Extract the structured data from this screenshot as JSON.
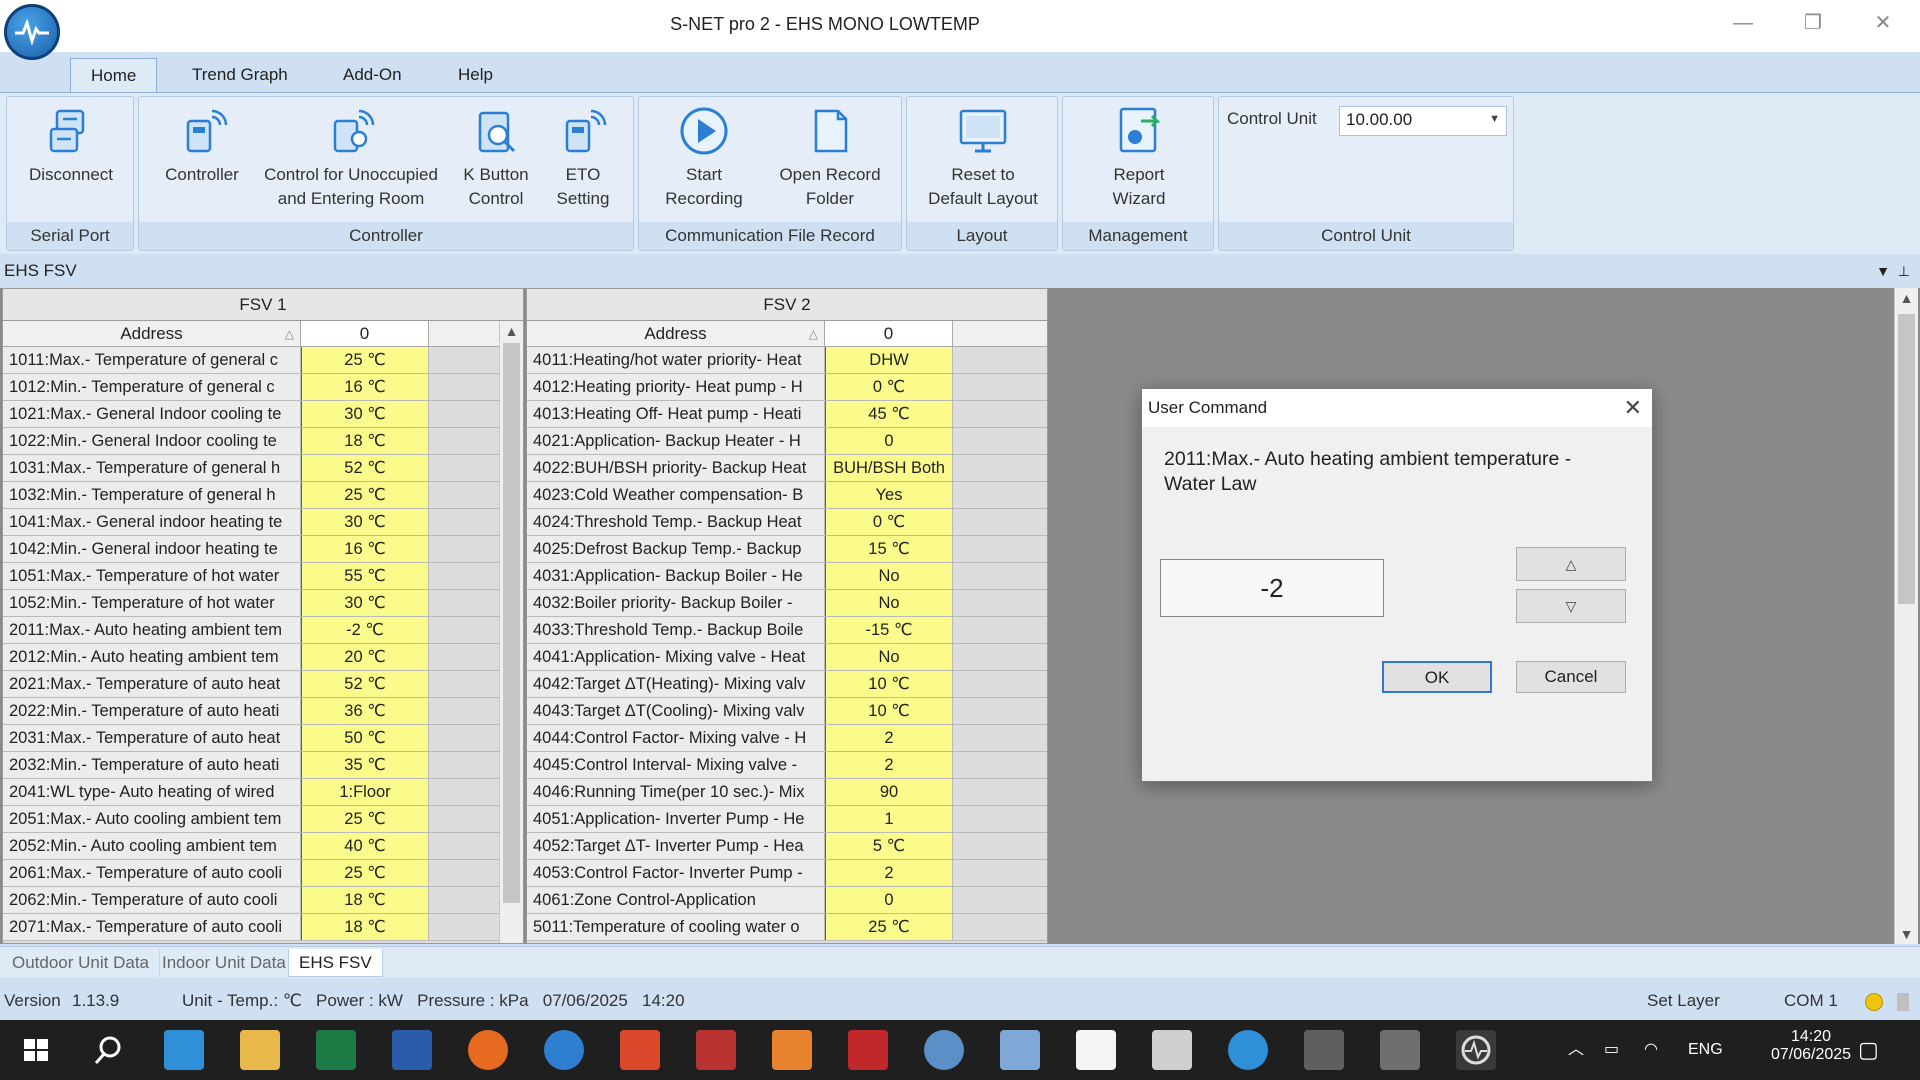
{
  "window": {
    "title": "S-NET pro 2 - EHS MONO LOWTEMP",
    "minimize": "—",
    "restore": "❐",
    "close": "✕"
  },
  "menu": {
    "tabs": [
      "Home",
      "Trend Graph",
      "Add-On",
      "Help"
    ]
  },
  "ribbon": {
    "serial_port": {
      "label": "Serial Port",
      "disconnect": "Disconnect"
    },
    "controller": {
      "label": "Controller",
      "controller": "Controller",
      "control_unoccupied_1": "Control for Unoccupied",
      "control_unoccupied_2": "and Entering Room",
      "k_button_1": "K Button",
      "k_button_2": "Control",
      "eto_1": "ETO",
      "eto_2": "Setting"
    },
    "file_record": {
      "label": "Communication File Record",
      "start_1": "Start",
      "start_2": "Recording",
      "open_1": "Open Record",
      "open_2": "Folder"
    },
    "layout": {
      "label": "Layout",
      "reset_1": "Reset to",
      "reset_2": "Default Layout"
    },
    "management": {
      "label": "Management",
      "report_1": "Report",
      "report_2": "Wizard"
    },
    "control_unit": {
      "label": "Control Unit",
      "field_label": "Control Unit",
      "value": "10.00.00"
    }
  },
  "panel": {
    "title": "EHS FSV"
  },
  "fsv1": {
    "title": "FSV 1",
    "col_address": "Address",
    "col_value": "0",
    "rows": [
      {
        "address": "1011:Max.- Temperature of general c",
        "value": "25 ℃"
      },
      {
        "address": "1012:Min.- Temperature of general c",
        "value": "16 ℃"
      },
      {
        "address": "1021:Max.- General Indoor cooling te",
        "value": "30 ℃"
      },
      {
        "address": "1022:Min.- General Indoor cooling te",
        "value": "18 ℃"
      },
      {
        "address": "1031:Max.- Temperature of general h",
        "value": "52 ℃"
      },
      {
        "address": "1032:Min.- Temperature of general h",
        "value": "25 ℃"
      },
      {
        "address": "1041:Max.- General indoor heating te",
        "value": "30 ℃"
      },
      {
        "address": "1042:Min.- General indoor heating te",
        "value": "16 ℃"
      },
      {
        "address": "1051:Max.- Temperature of hot water",
        "value": "55 ℃"
      },
      {
        "address": "1052:Min.- Temperature of hot water",
        "value": "30 ℃"
      },
      {
        "address": "2011:Max.- Auto heating ambient tem",
        "value": "-2 ℃"
      },
      {
        "address": "2012:Min.- Auto heating ambient tem",
        "value": "20 ℃"
      },
      {
        "address": "2021:Max.- Temperature of auto heat",
        "value": "52 ℃"
      },
      {
        "address": "2022:Min.- Temperature of auto heati",
        "value": "36 ℃"
      },
      {
        "address": "2031:Max.- Temperature of auto heat",
        "value": "50 ℃"
      },
      {
        "address": "2032:Min.- Temperature of auto heati",
        "value": "35 ℃"
      },
      {
        "address": "2041:WL type- Auto heating of wired",
        "value": "1:Floor"
      },
      {
        "address": "2051:Max.- Auto cooling ambient tem",
        "value": "25 ℃"
      },
      {
        "address": "2052:Min.- Auto cooling ambient tem",
        "value": "40 ℃"
      },
      {
        "address": "2061:Max.- Temperature of auto cooli",
        "value": "25 ℃"
      },
      {
        "address": "2062:Min.- Temperature of auto cooli",
        "value": "18 ℃"
      },
      {
        "address": "2071:Max.- Temperature of auto cooli",
        "value": "18 ℃"
      }
    ]
  },
  "fsv2": {
    "title": "FSV 2",
    "col_address": "Address",
    "col_value": "0",
    "rows": [
      {
        "address": "4011:Heating/hot water priority- Heat",
        "value": "DHW"
      },
      {
        "address": "4012:Heating priority- Heat pump - H",
        "value": "0 ℃"
      },
      {
        "address": "4013:Heating Off- Heat pump - Heati",
        "value": "45 ℃"
      },
      {
        "address": "4021:Application- Backup Heater - H",
        "value": "0"
      },
      {
        "address": "4022:BUH/BSH priority- Backup Heat",
        "value": "BUH/BSH Both"
      },
      {
        "address": "4023:Cold Weather compensation- B",
        "value": "Yes"
      },
      {
        "address": "4024:Threshold Temp.- Backup Heat",
        "value": "0 ℃"
      },
      {
        "address": "4025:Defrost Backup Temp.- Backup",
        "value": "15 ℃"
      },
      {
        "address": "4031:Application- Backup Boiler - He",
        "value": "No"
      },
      {
        "address": "4032:Boiler priority- Backup Boiler -",
        "value": "No"
      },
      {
        "address": "4033:Threshold Temp.- Backup Boile",
        "value": "-15 ℃"
      },
      {
        "address": "4041:Application- Mixing valve - Heat",
        "value": "No"
      },
      {
        "address": "4042:Target ΔT(Heating)- Mixing valv",
        "value": "10 ℃"
      },
      {
        "address": "4043:Target ΔT(Cooling)- Mixing valv",
        "value": "10 ℃"
      },
      {
        "address": "4044:Control Factor- Mixing valve - H",
        "value": "2"
      },
      {
        "address": "4045:Control Interval- Mixing valve -",
        "value": "2"
      },
      {
        "address": "4046:Running Time(per 10 sec.)- Mix",
        "value": "90"
      },
      {
        "address": "4051:Application- Inverter Pump - He",
        "value": "1"
      },
      {
        "address": "4052:Target ΔT- Inverter Pump - Hea",
        "value": "5 ℃"
      },
      {
        "address": "4053:Control Factor- Inverter Pump -",
        "value": "2"
      },
      {
        "address": "4061:Zone Control-Application",
        "value": "0"
      },
      {
        "address": "5011:Temperature of cooling water o",
        "value": "25 ℃"
      }
    ]
  },
  "doc_tabs": [
    "Outdoor Unit Data",
    "Indoor Unit Data",
    "EHS FSV"
  ],
  "status": {
    "version_label": "Version",
    "version": "1.13.9",
    "unit": "Unit - Temp.: ℃   Power : kW   Pressure : kPa   07/06/2025   14:20",
    "layer": "Set Layer",
    "port": "COM 1"
  },
  "dialog": {
    "title": "User Command",
    "prompt": "2011:Max.- Auto heating ambient temperature - Water Law",
    "value": "-2",
    "up": "△",
    "down": "▽",
    "ok": "OK",
    "cancel": "Cancel"
  },
  "taskbar": {
    "language": "ENG",
    "time": "14:20",
    "date": "07/06/2025"
  },
  "colors": {
    "cell_yellow": "#fbfb8c",
    "accent": "#2f78d0",
    "ribbon_bg": "#dfeaf7"
  }
}
